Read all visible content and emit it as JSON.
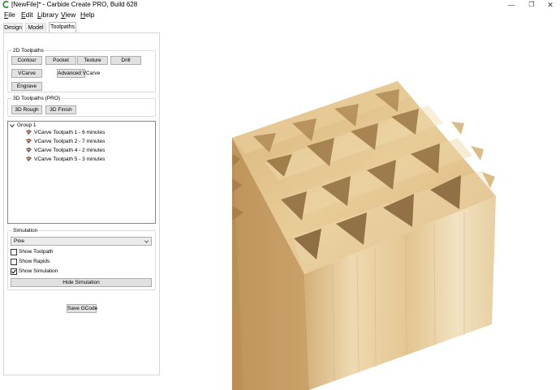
{
  "window": {
    "title": "[NewFile]* - Carbide Create PRO, Build 628",
    "minimize_glyph": "—",
    "maximize_glyph": "❐",
    "close_glyph": "✕"
  },
  "menu": {
    "file": {
      "first": "F",
      "rest": "ile"
    },
    "edit": {
      "first": "E",
      "rest": "dit"
    },
    "library": {
      "first": "L",
      "rest": "ibrary"
    },
    "view": {
      "first": "V",
      "rest": "iew"
    },
    "help": {
      "first": "H",
      "rest": "elp"
    }
  },
  "tabs": {
    "design": "Design",
    "model": "Model",
    "toolpaths": "Toolpaths",
    "active": "Toolpaths"
  },
  "toolpaths_2d": {
    "title": "2D Toolpaths",
    "contour": "Contour",
    "pocket": "Pocket",
    "texture": "Texture",
    "drill": "Drill",
    "vcarve": "VCarve",
    "advanced_vcarve": "Advanced VCarve",
    "engrave": "Engrave"
  },
  "toolpaths_3d": {
    "title": "3D Toolpaths (PRO)",
    "rough": "3D Rough",
    "finish": "3D Finish"
  },
  "toolpath_tree": {
    "group_label": "Group 1",
    "expanded": true,
    "items": [
      {
        "label": "VCarve Toolpath 1 - 6 minutes",
        "icon": "toolpath-icon"
      },
      {
        "label": "VCarve Toolpath 2 - 7 minutes",
        "icon": "toolpath-icon"
      },
      {
        "label": "VCarve Toolpath 4 - 2 minutes",
        "icon": "toolpath-icon"
      },
      {
        "label": "VCarve Toolpath 5 - 3 minutes",
        "icon": "toolpath-icon"
      }
    ]
  },
  "simulation": {
    "title": "Simulation",
    "material": "Pine",
    "show_toolpath": {
      "label": "Show Toolpath",
      "checked": false
    },
    "show_rapids": {
      "label": "Show Rapids",
      "checked": false
    },
    "show_simulation": {
      "label": "Show Simulation",
      "checked": true
    },
    "hide_button": "Hide Simulation"
  },
  "save_gcode": "Save GCode",
  "colors": {
    "wood_top": "#e4c38c",
    "wood_left": "#c9a36b",
    "wood_right": "#e9d1a4",
    "button_face": "#e1e1e1",
    "panel_border": "#d6d6d6"
  }
}
